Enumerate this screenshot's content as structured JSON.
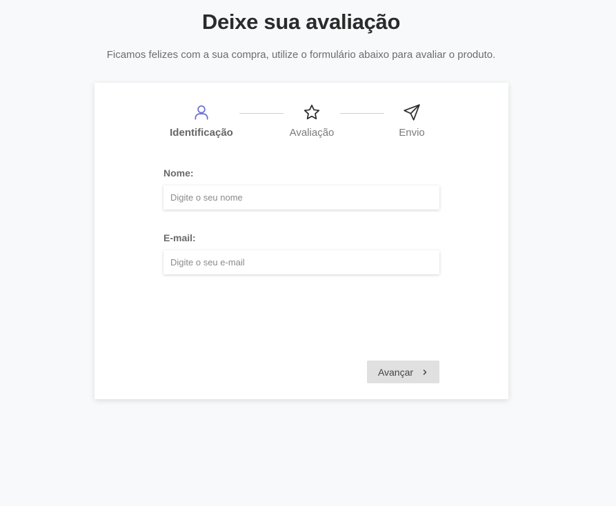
{
  "header": {
    "title": "Deixe sua avaliação",
    "subtitle": "Ficamos felizes com a sua compra, utilize o formulário abaixo para avaliar o produto."
  },
  "steps": [
    {
      "label": "Identificação",
      "icon": "user-icon",
      "active": true
    },
    {
      "label": "Avaliação",
      "icon": "star-icon",
      "active": false
    },
    {
      "label": "Envio",
      "icon": "send-icon",
      "active": false
    }
  ],
  "form": {
    "name_label": "Nome:",
    "name_placeholder": "Digite o seu nome",
    "name_value": "",
    "email_label": "E-mail:",
    "email_placeholder": "Digite o seu e-mail",
    "email_value": ""
  },
  "actions": {
    "next_label": "Avançar",
    "next_icon": "chevron-right-icon"
  },
  "colors": {
    "accent": "#6c6fd6",
    "background": "#f8f9fa",
    "button_bg": "#e0e0e0"
  }
}
